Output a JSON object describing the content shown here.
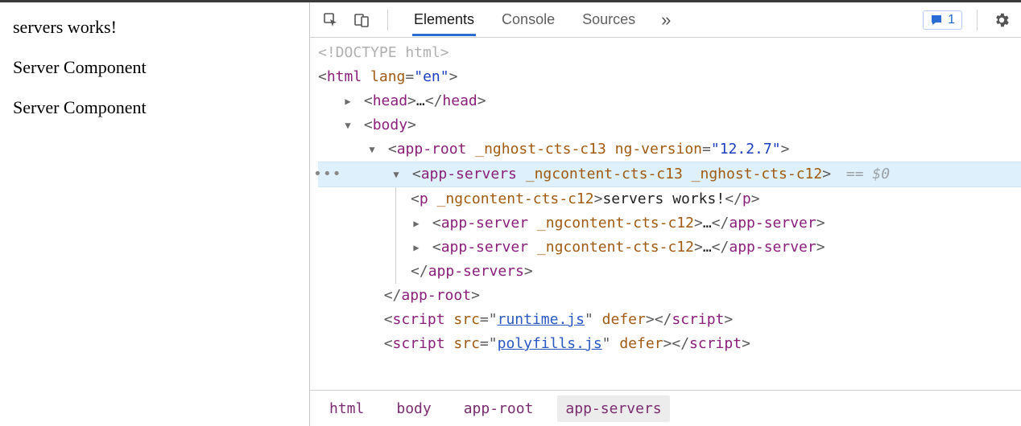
{
  "page": {
    "line1": "servers works!",
    "line2": "Server Component",
    "line3": "Server Component"
  },
  "toolbar": {
    "tabs": {
      "elements": "Elements",
      "console": "Console",
      "sources": "Sources"
    },
    "more": "»",
    "badge_count": "1"
  },
  "dom": {
    "doctype": "<!DOCTYPE html>",
    "html_open": {
      "tag": "html",
      "attr": "lang",
      "val": "\"en\""
    },
    "head": {
      "open": "head",
      "ell": "…",
      "close": "head"
    },
    "body_open": "body",
    "approot": {
      "tag": "app-root",
      "a1": "_nghost-cts-c13",
      "a2": "ng-version",
      "v2": "\"12.2.7\""
    },
    "appservers": {
      "tag": "app-servers",
      "a1": "_ngcontent-cts-c13",
      "a2": "_nghost-cts-c12",
      "eq": "== $0"
    },
    "p": {
      "tag": "p",
      "a": "_ngcontent-cts-c12",
      "txt": "servers works!"
    },
    "srv1": {
      "tag": "app-server",
      "a": "_ngcontent-cts-c12",
      "ell": "…"
    },
    "srv2": {
      "tag": "app-server",
      "a": "_ngcontent-cts-c12",
      "ell": "…"
    },
    "appservers_close": "app-servers",
    "approot_close": "app-root",
    "s1": {
      "tag": "script",
      "a": "src",
      "v": "runtime.js",
      "d": "defer"
    },
    "s2": {
      "tag": "script",
      "a": "src",
      "v": "polyfills.js",
      "d": "defer"
    }
  },
  "breadcrumb": {
    "b1": "html",
    "b2": "body",
    "b3": "app-root",
    "b4": "app-servers"
  }
}
